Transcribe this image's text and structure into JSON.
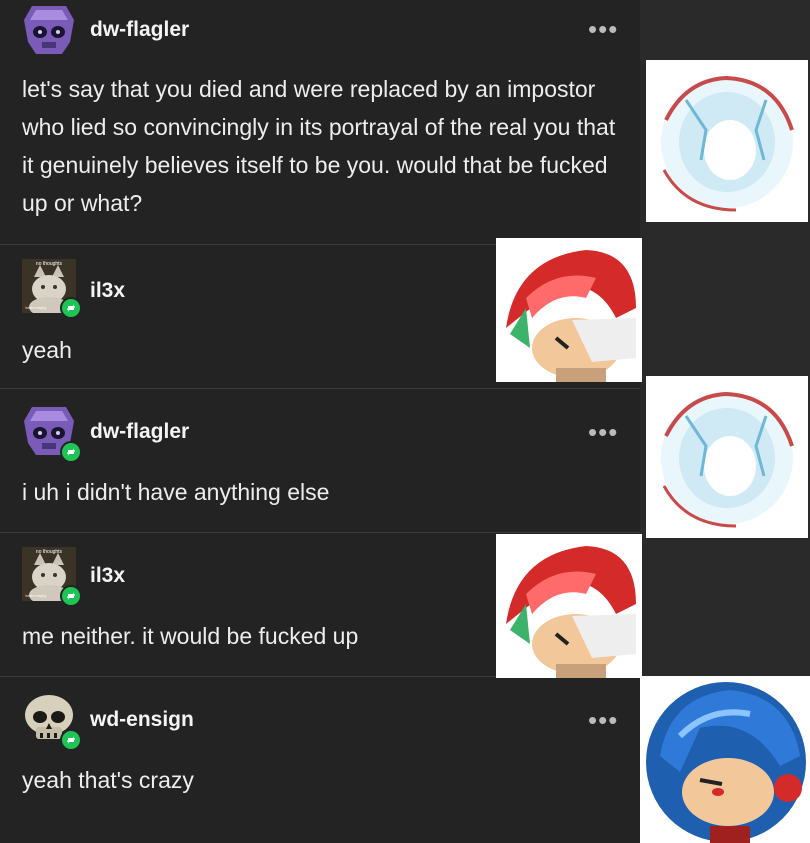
{
  "posts": [
    {
      "username": "dw-flagler",
      "menu": "•••",
      "text": "let's say that you died and were replaced by an impostor who lied so convincingly in its portrayal of the real you that it genuinely believes itself to be you. would that be fucked up or what?"
    },
    {
      "username": "il3x",
      "avatar_caption_top": "no thoughts",
      "avatar_caption_bottom": "brain empty",
      "text": "yeah"
    },
    {
      "username": "dw-flagler",
      "menu": "•••",
      "text": "i uh i didn't have anything else"
    },
    {
      "username": "il3x",
      "avatar_caption_top": "no thoughts",
      "avatar_caption_bottom": "brain empty",
      "text": "me neither. it would be fucked up"
    },
    {
      "username": "wd-ensign",
      "menu": "•••",
      "text": "yeah that's crazy"
    }
  ],
  "colors": {
    "background": "#232323",
    "reblog_badge": "#1ec456",
    "divider": "#3a3a3a"
  },
  "icons": [
    "crystal-skull-avatar-icon",
    "cat-avatar-icon",
    "skull-avatar-icon",
    "reblog-icon",
    "more-options-icon"
  ]
}
